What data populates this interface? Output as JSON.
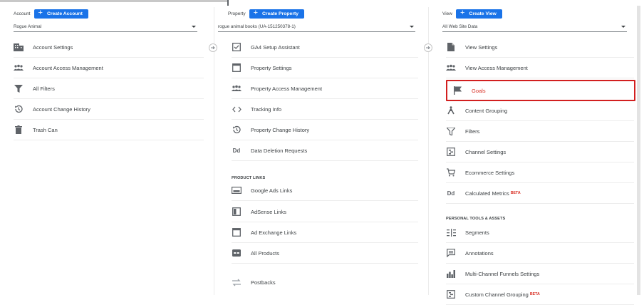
{
  "account": {
    "label": "Account",
    "create_label": "Create Account",
    "selected": "Rogue Animal",
    "items": [
      {
        "label": "Account Settings",
        "icon": "building-icon"
      },
      {
        "label": "Account Access Management",
        "icon": "people-icon"
      },
      {
        "label": "All Filters",
        "icon": "filter-icon"
      },
      {
        "label": "Account Change History",
        "icon": "history-icon"
      },
      {
        "label": "Trash Can",
        "icon": "trash-icon"
      }
    ]
  },
  "property": {
    "label": "Property",
    "create_label": "Create Property",
    "selected": "rogue animal books (UA-151250378-1)",
    "items": [
      {
        "label": "GA4 Setup Assistant",
        "icon": "checkbox-icon"
      },
      {
        "label": "Property Settings",
        "icon": "window-icon"
      },
      {
        "label": "Property Access Management",
        "icon": "people-icon"
      },
      {
        "label": "Tracking Info",
        "icon": "code-icon"
      },
      {
        "label": "Property Change History",
        "icon": "history-icon"
      },
      {
        "label": "Data Deletion Requests",
        "icon": "dd-icon"
      }
    ],
    "section_label": "PRODUCT LINKS",
    "links": [
      {
        "label": "Google Ads Links",
        "icon": "ads-icon"
      },
      {
        "label": "AdSense Links",
        "icon": "adsense-icon"
      },
      {
        "label": "Ad Exchange Links",
        "icon": "window-icon"
      },
      {
        "label": "All Products",
        "icon": "link-icon"
      },
      {
        "label": "Postbacks",
        "icon": "postback-icon"
      }
    ]
  },
  "view": {
    "label": "View",
    "create_label": "Create View",
    "selected": "All Web Site Data",
    "items": [
      {
        "label": "View Settings",
        "icon": "document-icon"
      },
      {
        "label": "View Access Management",
        "icon": "people-icon"
      },
      {
        "label": "Goals",
        "icon": "flag-icon"
      },
      {
        "label": "Content Grouping",
        "icon": "person-walk-icon"
      },
      {
        "label": "Filters",
        "icon": "filter-icon"
      },
      {
        "label": "Channel Settings",
        "icon": "channel-icon"
      },
      {
        "label": "Ecommerce Settings",
        "icon": "cart-icon"
      },
      {
        "label": "Calculated Metrics",
        "icon": "dd-icon",
        "badge": "BETA"
      }
    ],
    "section_label": "PERSONAL TOOLS & ASSETS",
    "tools": [
      {
        "label": "Segments",
        "icon": "segments-icon"
      },
      {
        "label": "Annotations",
        "icon": "comment-icon"
      },
      {
        "label": "Multi-Channel Funnels Settings",
        "icon": "bar-chart-icon"
      },
      {
        "label": "Custom Channel Grouping",
        "icon": "channel-icon",
        "badge": "BETA"
      }
    ]
  },
  "colors": {
    "primary": "#1a73e8",
    "highlight_border": "#d21f1f",
    "beta": "#d93025"
  }
}
